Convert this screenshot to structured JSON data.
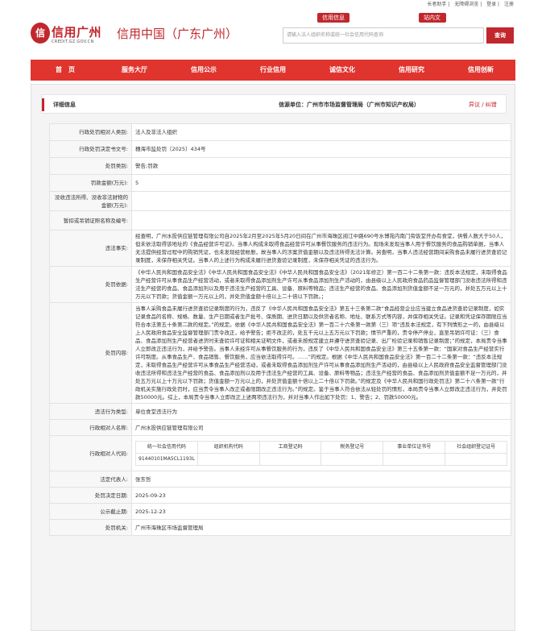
{
  "top_links": [
    "长者助手",
    "无障碍浏览",
    "登录",
    "注册"
  ],
  "top_tabs": [
    "信用信息",
    "站内文章"
  ],
  "header": {
    "logo_badge": "信",
    "logo_text": "信用广州",
    "logo_sub": "CREDIT.GZ.GOV.CN",
    "site_title": "信用中国（广东广州）",
    "search_placeholder": "请输入法人组织名称或统一社会信用代码查询",
    "search_button": "查询"
  },
  "nav": [
    "首　页",
    "服务大厅",
    "信用公示",
    "行业信用",
    "诚信文化",
    "信用研究",
    "信用创新"
  ],
  "info_bar": {
    "title": "详细信息",
    "source": "信源单位：广州市市场监督管理局（广州市知识产权局）",
    "dispute": "异议 / 纠错"
  },
  "rows": {
    "counterpart_type": {
      "label": "行政处罚相对人类别:",
      "value": "法人及非法人组织"
    },
    "decision_no": {
      "label": "行政处罚决定书文号:",
      "value": "穗海市监处罚〔2025〕434号"
    },
    "penalty_type": {
      "label": "处罚类别:",
      "value": "警告;罚款"
    },
    "fine_amount": {
      "label": "罚款金额(万元):",
      "value": "5"
    },
    "confiscation": {
      "label": "没收违法所得、没收非法财物的金额(万元):",
      "value": ""
    },
    "revoke": {
      "label": "暂扣或吊销证照名称及编号:",
      "value": ""
    },
    "facts": {
      "label": "违法事实:",
      "value": "经查明，广州水投供应链管理有限公司自2025年2月至2025年5月20日间在广州市海珠区阅江中路690号水博苑内南门旁饭堂开办有食堂，供餐人数大于50人，但未依法取得该地址的《食品经营许可证》。当事人构成未取得食品经营许可从事餐饮服务的违法行为。现场未发现当事人用于餐饮服务的食品购销单据，当事人无法提供经营过程中的购销凭证，也未发现经营帐册，故当事人的涉案货值金额以及违法所得无法计算。另查明，当事人违法经营期间采购食品未履行进货查验记录制度，未保存相关凭证。当事人的上述行为构成未履行进货查验记录制度，未保存相关凭证的违法行为。"
    },
    "basis": {
      "label": "处罚依据:",
      "value": "《中华人民共和国食品安全法》《中华人民共和国食品安全法》《中华人民共和国食品安全法》（2021年修正）第一百二十二条第一款：违反本法规定，未取得食品生产经营许可从事食品生产经营活动，或者未取得食品添加剂生产许可从事食品添加剂生产活动的，由县级以上人民政府食品药品监督管理部门没收违法所得和违法生产经营的食品、食品添加剂以及用于违法生产经营的工具、设备、原料等物品；违法生产经营的食品、食品添加剂货值金额不足一万元的，并处五万元以上十万元以下罚款；货值金额一万元以上的，并处货值金额十倍以上二十倍以下罚款。；"
    },
    "content": {
      "label": "处罚内容:",
      "value": "当事人采购食品未履行进货查验记录制度的行为，违反了《中华人民共和国食品安全法》第五十三条第二款“食品经营企业应当建立食品进货查验记录制度，如实记录食品的名称、规格、数量、生产日期或者生产批号、保质期、进货日期以及供货者名称、地址、联系方式等内容，并保存相关凭证。记录和凭证保存期限应当符合本法第五十条第二款的规定。”的规定。依据《中华人民共和国食品安全法》第一百二十六条第一款第（三）项“违反本法规定，有下列情形之一的，由县级以上人民政府食品安全监督管理部门责令改正，给予警告；拒不改正的，处五千元以上五万元以下罚款；情节严重的，责令停产停业，直至吊销许可证：（三）食品、食品添加剂生产经营者进货时未查验许可证和相关证明文件，或者未按规定建立并遵守进货查验记录、出厂检验记录和销售记录制度；”的规定，本局责令当事人立即改正违法行为，并给予警告。当事人未经许可从事餐饮服务的行为，违反了《中华人民共和国食品安全法》第三十五条第一款：“国家对食品生产经营实行许可制度。从事食品生产、食品销售、餐饮服务，应当依法取得许可。……”的规定。根据《中华人民共和国食品安全法》第一百二十二条第一款：“违反本法规定，未取得食品生产经营许可从事食品生产经营活动，或者未取得食品添加剂生产许可从事食品添加剂生产活动的，由县级以上人民政府食品安全监督管理部门没收违法所得和违法生产经营的食品、食品添加剂以及用于违法生产经营的工具、设备、原料等物品；违法生产经营的食品、食品添加剂货值金额不足一万元的，并处五万元以上十万元以下罚款；货值金额一万元以上的，并处货值金额十倍以上二十倍以下罚款。”的规定及《中华人民共和国行政处罚法》第二十八条第一款“行政机关实施行政处罚时，应当责令当事人改正或者限期改正违法行为。”的规定。鉴于当事人符合依法从轻处罚的情形，本局责令当事人立即改正违法行为，并处罚款50000元。综上，本局责令当事人立即改正上述两项违法行为，并对当事人作出如下处罚：1、警告；2、罚款50000元。"
    },
    "violation_type": {
      "label": "违法行为类型:",
      "value": "单位食堂违法行为"
    },
    "counterpart_name": {
      "label": "行政相对人名称:",
      "value": "广州水投供应链管理有限公司"
    },
    "counterpart_code": {
      "label": "行政相对人代码:"
    },
    "legal_rep": {
      "label": "法定代表人:",
      "value": "张东哲"
    },
    "decision_date": {
      "label": "处罚决定日期:",
      "value": "2025-09-23"
    },
    "publish_date": {
      "label": "公示截止期:",
      "value": "2025-12-23"
    },
    "authority": {
      "label": "处罚机关:",
      "value": "广州市海珠区市场监督管理局"
    }
  },
  "codes": {
    "headers": [
      "统一社会信用代码",
      "组织机构代码",
      "工商登记码",
      "税务登记号",
      "事业单位证书号",
      "社会组织登记证号"
    ],
    "values": [
      "91440101MA5CL1193L",
      "",
      "",
      "",
      "",
      ""
    ]
  },
  "colors": {
    "brand_red": "#c1272d",
    "nav_red": "#e0342e"
  }
}
